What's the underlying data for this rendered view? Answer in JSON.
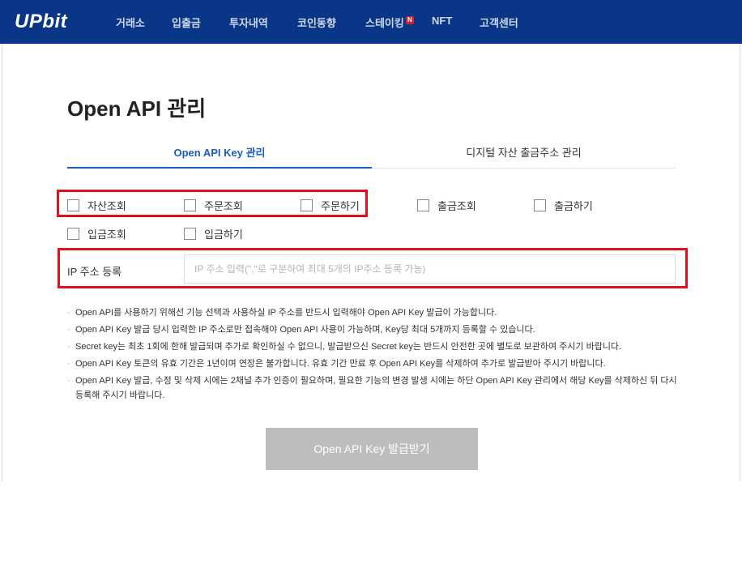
{
  "header": {
    "logo": "UPbit",
    "nav": [
      {
        "label": "거래소"
      },
      {
        "label": "입출금"
      },
      {
        "label": "투자내역"
      },
      {
        "label": "코인동향"
      },
      {
        "label": "스테이킹",
        "badge": "N"
      },
      {
        "label": "NFT"
      },
      {
        "label": "고객센터"
      }
    ]
  },
  "page": {
    "title": "Open API 관리",
    "tabs": [
      {
        "label": "Open API Key 관리",
        "active": true
      },
      {
        "label": "디지털 자산 출금주소 관리",
        "active": false
      }
    ],
    "permissions": [
      {
        "label": "자산조회",
        "checked": false
      },
      {
        "label": "주문조회",
        "checked": false
      },
      {
        "label": "주문하기",
        "checked": false
      },
      {
        "label": "출금조회",
        "checked": false
      },
      {
        "label": "출금하기",
        "checked": false
      },
      {
        "label": "입금조회",
        "checked": false
      },
      {
        "label": "입금하기",
        "checked": false
      }
    ],
    "ip": {
      "label": "IP 주소 등록",
      "value": "",
      "placeholder": "IP 주소 입력(\",\"로 구분하여 최대 5개의 IP주소 등록 가능)"
    },
    "notes": [
      "Open API를 사용하기 위해선 기능 선택과 사용하실 IP 주소를 반드시 입력해야 Open API Key 발급이 가능합니다.",
      "Open API Key 발급 당시 입력한 IP 주소로만 접속해야 Open API 사용이 가능하며, Key당 최대 5개까지 등록할 수 있습니다.",
      "Secret key는 최초 1회에 한해 발급되며 추가로 확인하실 수 없으니, 발급받으신 Secret key는 반드시 안전한 곳에 별도로 보관하여 주시기 바랍니다.",
      "Open API Key 토큰의 유효 기간은 1년이며 연장은 불가합니다. 유효 기간 만료 후 Open API Key를 삭제하여 추가로 발급받아 주시기 바랍니다.",
      "Open API Key 발급, 수정 및 삭제 시에는 2채널 추가 인증이 필요하며, 필요한 기능의 변경 발생 시에는 하단 Open API Key 관리에서 해당 Key를 삭제하신 뒤 다시 등록해 주시기 바랍니다."
    ],
    "submit_label": "Open API Key 발급받기"
  },
  "colors": {
    "header_bg": "#093687",
    "accent": "#1b5bc6",
    "highlight": "#e0101e",
    "button_disabled": "#bdbdbd"
  }
}
